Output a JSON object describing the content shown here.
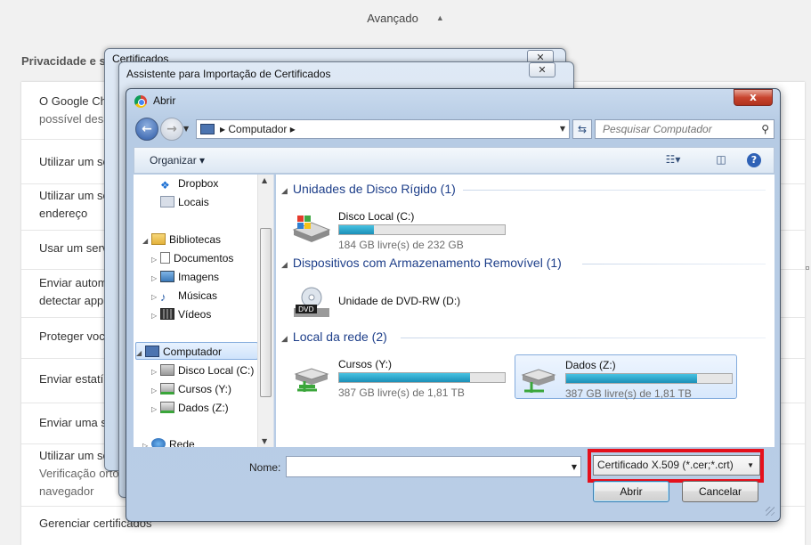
{
  "background": {
    "header_label": "Avançado",
    "section_title": "Privacidade e se",
    "rows": [
      {
        "line1": "O Google Ch",
        "line2": "possível des"
      },
      {
        "line1": "Utilizar um se",
        "line2": ""
      },
      {
        "line1": "Utilizar um se",
        "line2": "endereço"
      },
      {
        "line1": "Usar um serv",
        "line2": ""
      },
      {
        "line1": "Enviar autom",
        "line2": "detectar app"
      },
      {
        "line1": "Proteger voc",
        "line2": ""
      },
      {
        "line1": "Enviar estatí",
        "line2": ""
      },
      {
        "line1": "Enviar uma s",
        "line2": ""
      },
      {
        "line1": "Utilizar um se",
        "line2": "Verificação orto",
        "line3": "navegador"
      },
      {
        "line1": "Gerenciar certificados",
        "line2": ""
      }
    ]
  },
  "back_window_1": {
    "title": "Certificados"
  },
  "back_window_2": {
    "title": "Assistente para Importação de Certificados"
  },
  "dialog": {
    "title": "Abrir",
    "close_label": "x",
    "address_crumb": "Computador",
    "search_placeholder": "Pesquisar Computador",
    "organize_label": "Organizar"
  },
  "tree": [
    {
      "label": "Dropbox",
      "icon": "dropbox-icon",
      "level": 2
    },
    {
      "label": "Locais",
      "icon": "places-icon",
      "level": 2
    },
    {
      "label": "Bibliotecas",
      "icon": "library-icon",
      "level": 1
    },
    {
      "label": "Documentos",
      "icon": "documents-icon",
      "level": 2
    },
    {
      "label": "Imagens",
      "icon": "images-icon",
      "level": 2
    },
    {
      "label": "Músicas",
      "icon": "music-icon",
      "level": 2
    },
    {
      "label": "Vídeos",
      "icon": "videos-icon",
      "level": 2
    },
    {
      "label": "Computador",
      "icon": "computer-icon",
      "level": 1,
      "selected": true
    },
    {
      "label": "Disco Local (C:)",
      "icon": "local-disk-icon",
      "level": 2
    },
    {
      "label": "Cursos (Y:)",
      "icon": "network-drive-icon",
      "level": 2
    },
    {
      "label": "Dados (Z:)",
      "icon": "network-drive-icon",
      "level": 2
    },
    {
      "label": "Rede",
      "icon": "network-icon",
      "level": 1
    }
  ],
  "groups": {
    "hard_disks": "Unidades de Disco Rígido (1)",
    "removable": "Dispositivos com Armazenamento Removível (1)",
    "network": "Local da rede (2)"
  },
  "drives": {
    "c": {
      "name": "Disco Local (C:)",
      "free": "184 GB livre(s) de 232 GB",
      "used_fraction": 0.21
    },
    "dvd": {
      "name": "Unidade de DVD-RW (D:)",
      "icon_text": "DVD"
    },
    "y": {
      "name": "Cursos (Y:)",
      "free": "387 GB livre(s) de 1,81 TB",
      "used_fraction": 0.79
    },
    "z": {
      "name": "Dados (Z:)",
      "free": "387 GB livre(s) de 1,81 TB",
      "used_fraction": 0.79
    }
  },
  "footer": {
    "name_label": "Nome:",
    "name_value": "",
    "filter_value": "Certificado X.509 (*.cer;*.crt)",
    "open_label": "Abrir",
    "cancel_label": "Cancelar"
  },
  "colors": {
    "highlight": "#e5101c",
    "link": "#1e3f8a",
    "progress": "#1b8fb8"
  }
}
